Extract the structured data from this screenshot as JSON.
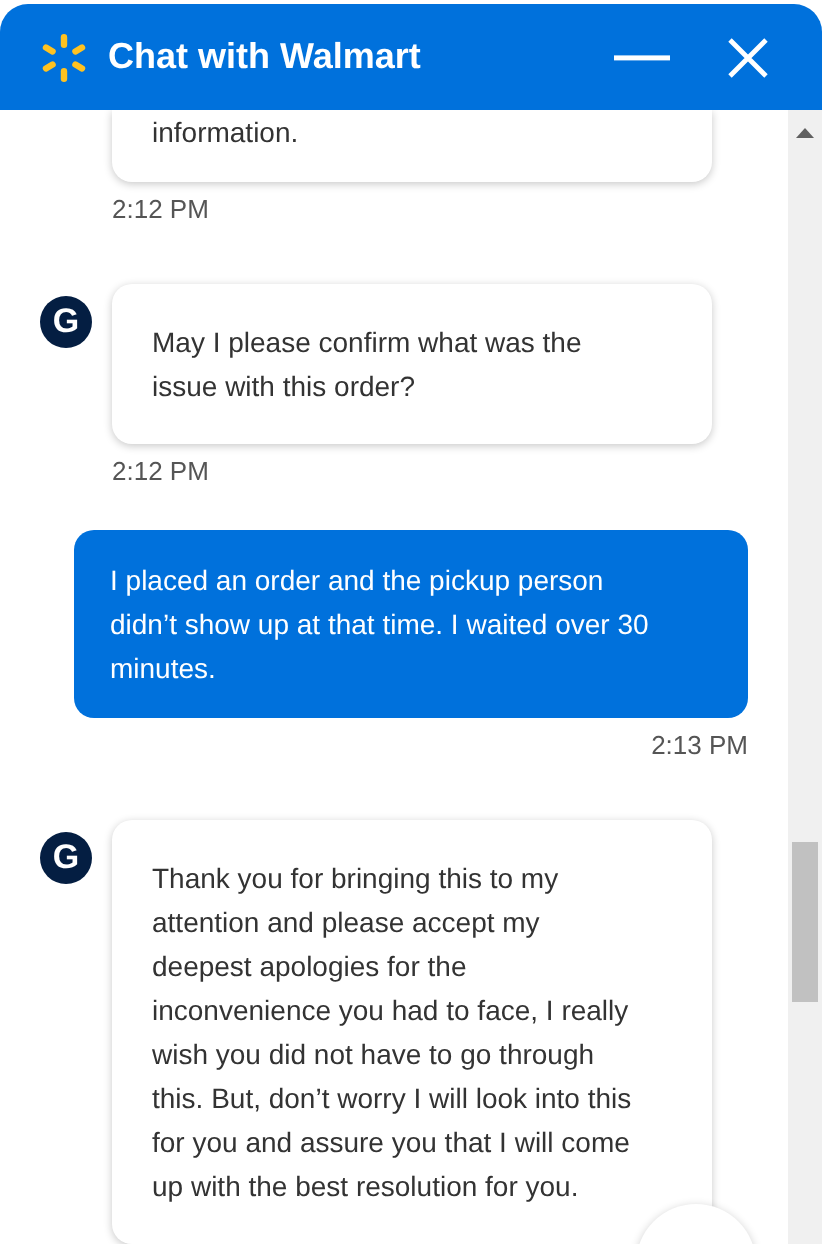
{
  "window": {
    "title": "Chat with Walmart"
  },
  "messages": [
    {
      "kind": "agent",
      "text": "information.",
      "time": "2:12 PM",
      "clipped": true
    },
    {
      "kind": "agent",
      "avatar": "G",
      "text": "May I please confirm what was the issue with this order?",
      "time": "2:12 PM"
    },
    {
      "kind": "user",
      "text": "I placed an order and the pickup person didn’t show up at that time. I waited over 30 minutes.",
      "time": "2:13 PM"
    },
    {
      "kind": "agent",
      "avatar": "G",
      "text": "Thank you for bringing this to my attention and please accept my deepest apologies for the inconvenience you had to face, I really wish you did not have to go through this. But, don’t worry I will look into this for you and assure you that I will come up with the best resolution for you."
    }
  ]
}
